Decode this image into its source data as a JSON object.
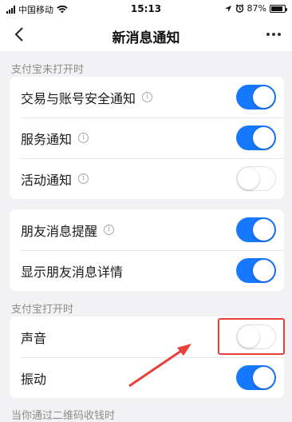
{
  "status_bar": {
    "carrier": "中国移动",
    "time": "15:13",
    "battery_percent": "87%",
    "battery_level": 0.87
  },
  "nav": {
    "title": "新消息通知"
  },
  "sections": {
    "closed_header": "支付宝未打开时",
    "open_header": "支付宝打开时",
    "bottom_header": "当你通过二维码收钱时"
  },
  "card1": {
    "items": [
      {
        "label": "交易与账号安全通知",
        "has_info": true,
        "enabled": true
      },
      {
        "label": "服务通知",
        "has_info": true,
        "enabled": true
      },
      {
        "label": "活动通知",
        "has_info": true,
        "enabled": false
      }
    ]
  },
  "card2": {
    "items": [
      {
        "label": "朋友消息提醒",
        "has_info": true,
        "enabled": true
      },
      {
        "label": "显示朋友消息详情",
        "has_info": false,
        "enabled": true
      }
    ]
  },
  "card3": {
    "items": [
      {
        "label": "声音",
        "has_info": false,
        "enabled": false
      },
      {
        "label": "振动",
        "has_info": false,
        "enabled": true
      }
    ]
  },
  "colors": {
    "accent": "#1677ff",
    "annotation": "#e8403a",
    "background": "#f2f2f5"
  },
  "icons": {
    "info": "info-circle-icon",
    "back": "chevron-left-icon",
    "more": "more-dots-icon"
  }
}
